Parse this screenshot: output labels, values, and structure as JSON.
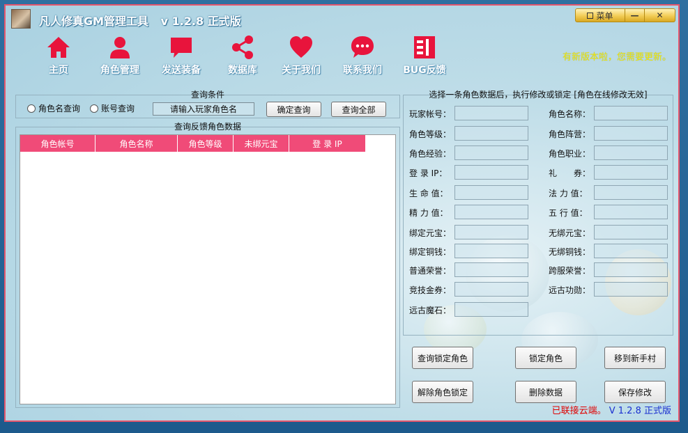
{
  "window": {
    "title": "凡人修真GM管理工具",
    "version": "v 1.2.8 正式版",
    "menu_label": "菜单",
    "minimize_label": "—",
    "close_label": "✕"
  },
  "nav": [
    {
      "label": "主页",
      "icon": "home-icon"
    },
    {
      "label": "角色管理",
      "icon": "user-icon"
    },
    {
      "label": "发送装备",
      "icon": "message-icon"
    },
    {
      "label": "数据库",
      "icon": "share-icon"
    },
    {
      "label": "关于我们",
      "icon": "heart-icon"
    },
    {
      "label": "联系我们",
      "icon": "chat-icon"
    },
    {
      "label": "BUG反馈",
      "icon": "bug-report-icon"
    }
  ],
  "update_notice": "有新版本啦，您需要更新。",
  "query": {
    "title": "查询条件",
    "radio_name": "角色名查询",
    "radio_account": "账号查询",
    "input_placeholder": "请输入玩家角色名",
    "confirm_button": "确定查询",
    "query_all_button": "查询全部"
  },
  "results": {
    "title": "查询反馈角色数据",
    "columns": [
      "角色帐号",
      "角色名称",
      "角色等级",
      "未绑元宝",
      "登 录 IP"
    ]
  },
  "detail": {
    "title": "选择一条角色数据后，执行修改或锁定 [角色在线修改无效]",
    "left_fields": [
      "玩家帐号：",
      "角色等级：",
      "角色经验：",
      "登 录 IP：",
      "生 命 值：",
      "精 力 值：",
      "绑定元宝：",
      "绑定铜钱：",
      "普通荣誉：",
      "竞技金券：",
      "远古魔石："
    ],
    "right_fields": [
      "角色名称：",
      "角色阵营：",
      "角色职业：",
      "礼　　券：",
      "法 力 值：",
      "五 行 值：",
      "无绑元宝：",
      "无绑铜钱：",
      "跨服荣誉：",
      "远古功勋："
    ]
  },
  "actions": {
    "query_locked": "查询锁定角色",
    "lock_role": "锁定角色",
    "move_newbie": "移到新手村",
    "unlock_role": "解除角色锁定",
    "delete_data": "删除数据",
    "save_changes": "保存修改"
  },
  "status": {
    "connection": "已联接云端。",
    "version": "V 1.2.8 正式版"
  },
  "colors": {
    "accent": "#e8143c",
    "table_header": "#f04b78",
    "notice": "#f2e800",
    "status_connection": "#e00000",
    "status_version": "#1a2fd0"
  }
}
